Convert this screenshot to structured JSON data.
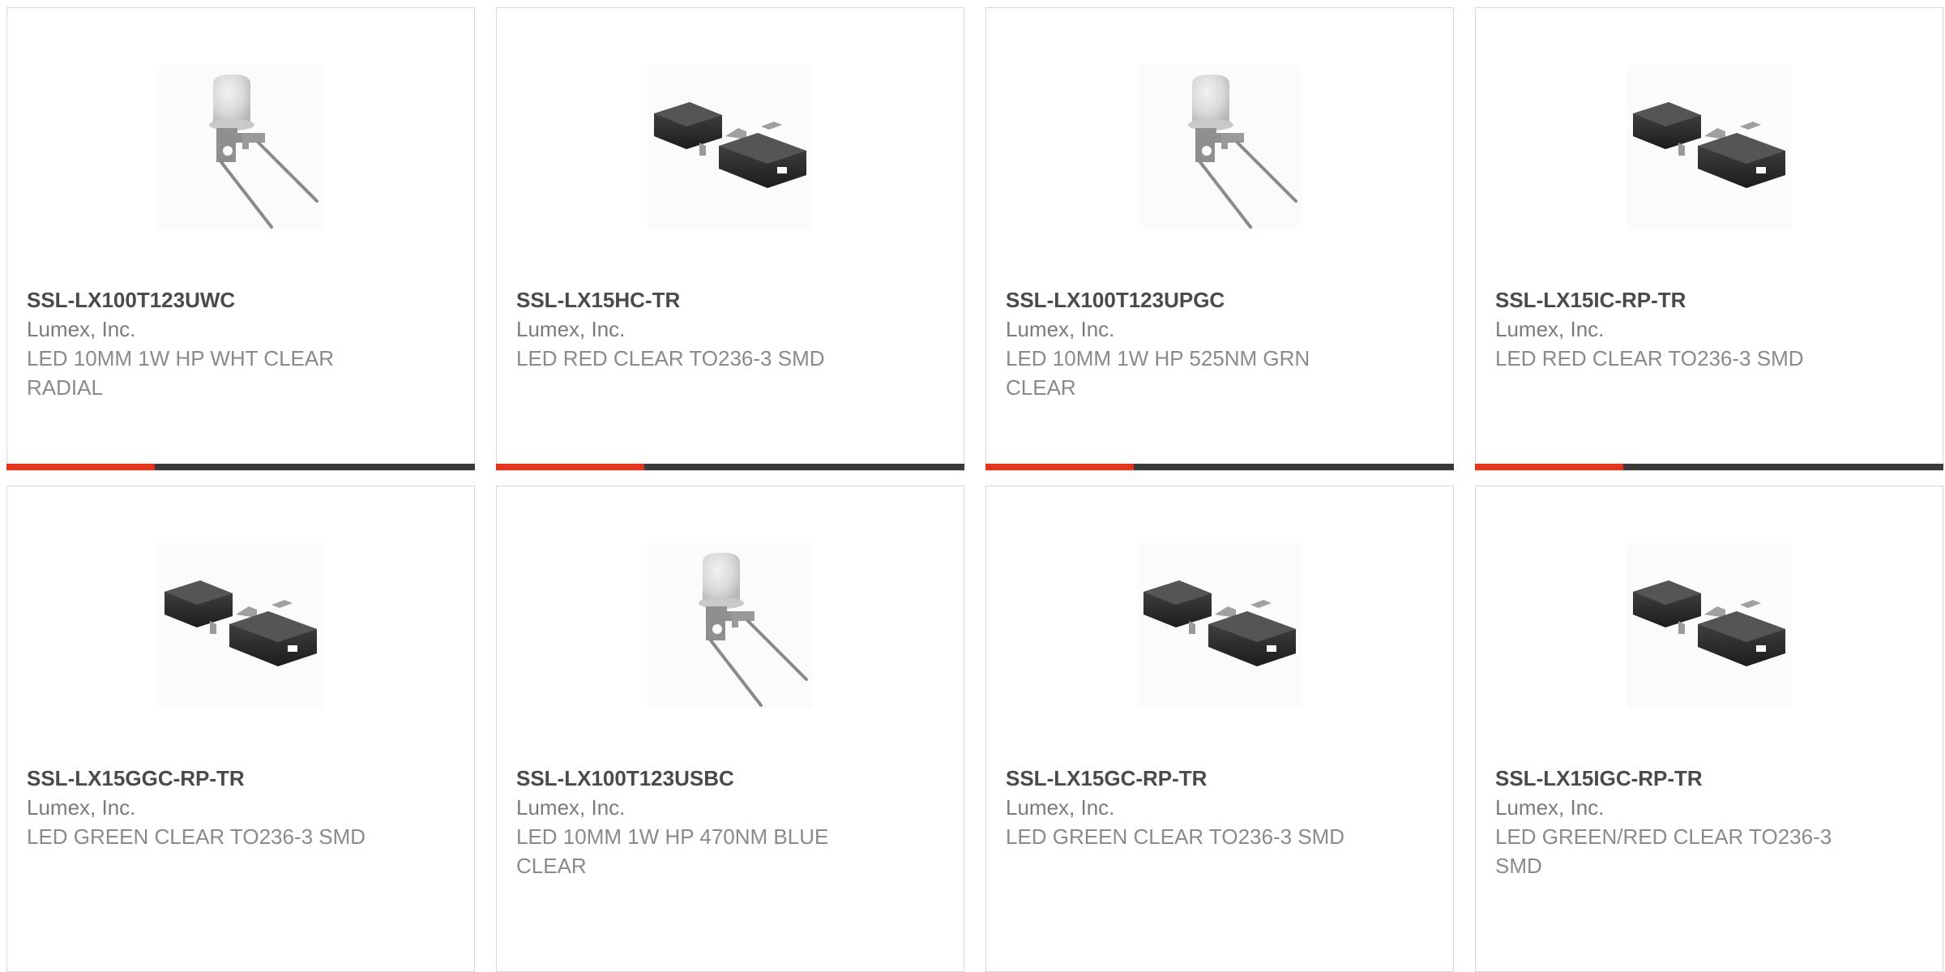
{
  "accent_color": "#e3341c",
  "bar_color": "#3a3a3a",
  "products": [
    {
      "part_number": "SSL-LX100T123UWC",
      "manufacturer": "Lumex, Inc.",
      "description": "LED 10MM 1W HP WHT CLEAR RADIAL",
      "image": "led-radial-icon"
    },
    {
      "part_number": "SSL-LX15HC-TR",
      "manufacturer": "Lumex, Inc.",
      "description": "LED RED CLEAR TO236-3 SMD",
      "image": "led-smd-icon"
    },
    {
      "part_number": "SSL-LX100T123UPGC",
      "manufacturer": "Lumex, Inc.",
      "description": "LED 10MM 1W HP 525NM GRN CLEAR",
      "image": "led-radial-icon"
    },
    {
      "part_number": "SSL-LX15IC-RP-TR",
      "manufacturer": "Lumex, Inc.",
      "description": "LED RED CLEAR TO236-3 SMD",
      "image": "led-smd-icon"
    },
    {
      "part_number": "SSL-LX15GGC-RP-TR",
      "manufacturer": "Lumex, Inc.",
      "description": "LED GREEN CLEAR TO236-3 SMD",
      "image": "led-smd-icon"
    },
    {
      "part_number": "SSL-LX100T123USBC",
      "manufacturer": "Lumex, Inc.",
      "description": "LED 10MM 1W HP 470NM BLUE CLEAR",
      "image": "led-radial-icon"
    },
    {
      "part_number": "SSL-LX15GC-RP-TR",
      "manufacturer": "Lumex, Inc.",
      "description": "LED GREEN CLEAR TO236-3 SMD",
      "image": "led-smd-icon"
    },
    {
      "part_number": "SSL-LX15IGC-RP-TR",
      "manufacturer": "Lumex, Inc.",
      "description": "LED GREEN/RED CLEAR TO236-3 SMD",
      "image": "led-smd-icon"
    }
  ]
}
